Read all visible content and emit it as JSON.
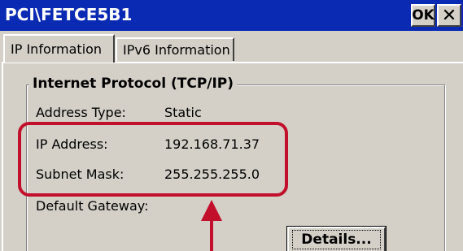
{
  "window": {
    "title": "PCI\\FETCE5B1",
    "ok_label": "OK",
    "close_glyph": "✕"
  },
  "tabs": [
    {
      "label": "IP Information",
      "active": true
    },
    {
      "label": "IPv6 Information",
      "active": false
    }
  ],
  "group": {
    "title": "Internet Protocol (TCP/IP)",
    "rows": [
      {
        "label": "Address Type:",
        "value": "Static"
      },
      {
        "label": "IP Address:",
        "value": "192.168.71.37"
      },
      {
        "label": "Subnet Mask:",
        "value": "255.255.255.0"
      },
      {
        "label": "Default Gateway:",
        "value": ""
      }
    ]
  },
  "details_button": {
    "label": "Details..."
  },
  "colors": {
    "titlebar": "#0a2ab4",
    "annotation": "#c2102c",
    "face": "#d4d0c8"
  }
}
